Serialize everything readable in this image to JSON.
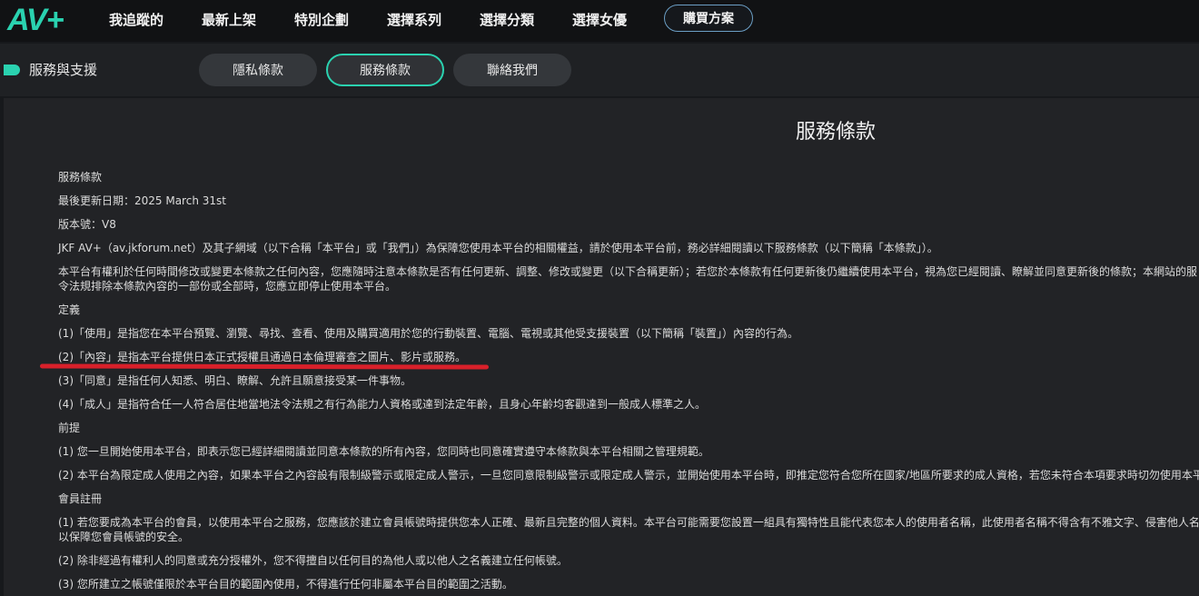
{
  "header": {
    "logo": "AV+",
    "nav": [
      "我追蹤的",
      "最新上架",
      "特別企劃",
      "選擇系列",
      "選擇分類",
      "選擇女優"
    ],
    "buy_label": "購買方案"
  },
  "subnav": {
    "section": "服務與支援",
    "tabs": [
      {
        "label": "隱私條款",
        "active": false
      },
      {
        "label": "服務條款",
        "active": true
      },
      {
        "label": "聯絡我們",
        "active": false
      }
    ]
  },
  "page": {
    "title": "服務條款",
    "lines": [
      "服務條款",
      "最後更新日期：2025 March 31st",
      "版本號：V8",
      "JKF AV+（av.jkforum.net）及其子網域（以下合稱「本平台」或「我們」）為保障您使用本平台的相關權益，請於使用本平台前，務必詳細閱讀以下服務條款（以下簡稱「本條款」）。",
      "本平台有權利於任何時間修改或變更本條款之任何內容，您應隨時注意本條款是否有任何更新、調整、修改或變更（以下合稱更新）；若您於本條款有任何更新後仍繼續使用本平台，視為您已經閱讀、瞭解並同意更新後的條款；本網站的服",
      "令法規排除本條款內容的一部份或全部時，您應立即停止使用本平台。",
      "定義",
      "(1)「使用」是指您在本平台預覽、瀏覽、尋找、查看、使用及購買適用於您的行動裝置、電腦、電視或其他受支援裝置（以下簡稱「裝置」）內容的行為。",
      "(2)「內容」是指本平台提供日本正式授權且通過日本倫理審查之圖片、影片或服務。",
      "(3)「同意」是指任何人知悉、明白、瞭解、允許且願意接受某一件事物。",
      "(4)「成人」是指符合任一人符合居住地當地法令法規之有行為能力人資格或達到法定年齡，且身心年齡均客觀達到一般成人標準之人。",
      "前提",
      "(1) 您一旦開始使用本平台，即表示您已經詳細閱讀並同意本條款的所有內容，您同時也同意確實遵守本條款與本平台相關之管理規範。",
      "(2) 本平台為限定成人使用之內容，如果本平台之內容設有限制級警示或限定成人警示，一旦您同意限制級警示或限定成人警示，並開始使用本平台時，即推定您符合您所在國家/地區所要求的成人資格，若您未符合本項要求時切勿使用本平",
      "會員註冊",
      "(1) 若您要成為本平台的會員，以使用本平台之服務，您應該於建立會員帳號時提供您本人正確、最新且完整的個人資料。本平台可能需要您設置一組具有獨特性且能代表您本人的使用者名稱，此使用者名稱不得含有不雅文字、侵害他人名聲",
      "以保障您會員帳號的安全。",
      "(2) 除非經過有權利人的同意或充分授權外，您不得擅自以任何目的為他人或以他人之名義建立任何帳號。",
      "(3) 您所建立之帳號僅限於本平台目的範圍內使用，不得進行任何非屬本平台目的範圍之活動。"
    ]
  },
  "colors": {
    "accent": "#2ad2b0",
    "highlight_underline": "#d8202a"
  }
}
